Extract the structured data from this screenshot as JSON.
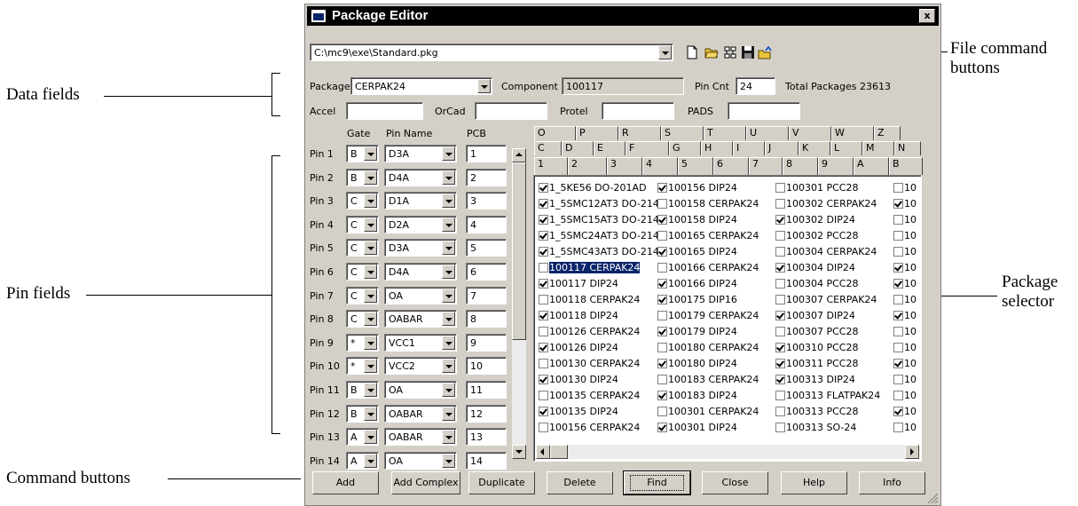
{
  "annotations": {
    "data_fields": "Data fields",
    "pin_fields": "Pin fields",
    "command_buttons": "Command buttons",
    "file_command_buttons_line1": "File command",
    "file_command_buttons_line2": "buttons",
    "package_selector_line1": "Package",
    "package_selector_line2": "selector"
  },
  "window": {
    "title": "Package Editor",
    "close_glyph": "x",
    "file_path": "C:\\mc9\\exe\\Standard.pkg",
    "file_icons": [
      "new-file-icon",
      "open-folder-icon",
      "tree-icon",
      "save-disk-icon",
      "export-folder-icon"
    ]
  },
  "data_fields": {
    "package_label": "Package",
    "package_value": "CERPAK24",
    "component_label": "Component",
    "component_value": "100117",
    "pin_cnt_label": "Pin Cnt",
    "pin_cnt_value": "24",
    "total_packages": "Total Packages 23613",
    "accel_label": "Accel",
    "accel_value": "",
    "orcad_label": "OrCad",
    "orcad_value": "",
    "protel_label": "Protel",
    "protel_value": "",
    "pads_label": "PADS",
    "pads_value": ""
  },
  "pin_headers": {
    "gate": "Gate",
    "pin_name": "Pin Name",
    "pcb": "PCB"
  },
  "pins": [
    {
      "label": "Pin 1",
      "gate": "B",
      "name": "D3A",
      "pcb": "1"
    },
    {
      "label": "Pin 2",
      "gate": "B",
      "name": "D4A",
      "pcb": "2"
    },
    {
      "label": "Pin 3",
      "gate": "C",
      "name": "D1A",
      "pcb": "3"
    },
    {
      "label": "Pin 4",
      "gate": "C",
      "name": "D2A",
      "pcb": "4"
    },
    {
      "label": "Pin 5",
      "gate": "C",
      "name": "D3A",
      "pcb": "5"
    },
    {
      "label": "Pin 6",
      "gate": "C",
      "name": "D4A",
      "pcb": "6"
    },
    {
      "label": "Pin 7",
      "gate": "C",
      "name": "OA",
      "pcb": "7"
    },
    {
      "label": "Pin 8",
      "gate": "C",
      "name": "OABAR",
      "pcb": "8"
    },
    {
      "label": "Pin 9",
      "gate": "*",
      "name": "VCC1",
      "pcb": "9"
    },
    {
      "label": "Pin 10",
      "gate": "*",
      "name": "VCC2",
      "pcb": "10"
    },
    {
      "label": "Pin 11",
      "gate": "B",
      "name": "OA",
      "pcb": "11"
    },
    {
      "label": "Pin 12",
      "gate": "B",
      "name": "OABAR",
      "pcb": "12"
    },
    {
      "label": "Pin 13",
      "gate": "A",
      "name": "OABAR",
      "pcb": "13"
    },
    {
      "label": "Pin 14",
      "gate": "A",
      "name": "OA",
      "pcb": "14"
    }
  ],
  "tabs": {
    "row1": [
      "O",
      "P",
      "R",
      "S",
      "T",
      "U",
      "V",
      "W",
      "Z"
    ],
    "row2": [
      "C",
      "D",
      "E",
      "F",
      "G",
      "H",
      "I",
      "J",
      "K",
      "L",
      "M",
      "N"
    ],
    "row3": [
      "1",
      "2",
      "3",
      "4",
      "5",
      "6",
      "7",
      "8",
      "9",
      "A",
      "B"
    ]
  },
  "package_list": [
    [
      {
        "text": "1_5KE56 DO-201AD",
        "checked": true
      },
      {
        "text": "1_5SMC12AT3 DO-214",
        "checked": true
      },
      {
        "text": "1_5SMC15AT3 DO-214",
        "checked": true
      },
      {
        "text": "1_5SMC24AT3 DO-214",
        "checked": true
      },
      {
        "text": "1_5SMC43AT3 DO-214",
        "checked": true
      },
      {
        "text": "100117 CERPAK24",
        "checked": false,
        "selected": true
      },
      {
        "text": "100117 DIP24",
        "checked": true
      },
      {
        "text": "100118 CERPAK24",
        "checked": false
      },
      {
        "text": "100118 DIP24",
        "checked": true
      },
      {
        "text": "100126 CERPAK24",
        "checked": false
      },
      {
        "text": "100126 DIP24",
        "checked": true
      },
      {
        "text": "100130 CERPAK24",
        "checked": false
      },
      {
        "text": "100130 DIP24",
        "checked": true
      },
      {
        "text": "100135 CERPAK24",
        "checked": false
      },
      {
        "text": "100135 DIP24",
        "checked": true
      },
      {
        "text": "100156 CERPAK24",
        "checked": false
      }
    ],
    [
      {
        "text": "100156 DIP24",
        "checked": true
      },
      {
        "text": "100158 CERPAK24",
        "checked": false
      },
      {
        "text": "100158 DIP24",
        "checked": true
      },
      {
        "text": "100165 CERPAK24",
        "checked": false
      },
      {
        "text": "100165 DIP24",
        "checked": true
      },
      {
        "text": "100166 CERPAK24",
        "checked": false
      },
      {
        "text": "100166 DIP24",
        "checked": true
      },
      {
        "text": "100175 DIP16",
        "checked": true
      },
      {
        "text": "100179 CERPAK24",
        "checked": false
      },
      {
        "text": "100179 DIP24",
        "checked": true
      },
      {
        "text": "100180 CERPAK24",
        "checked": false
      },
      {
        "text": "100180 DIP24",
        "checked": true
      },
      {
        "text": "100183 CERPAK24",
        "checked": false
      },
      {
        "text": "100183 DIP24",
        "checked": true
      },
      {
        "text": "100301 CERPAK24",
        "checked": false
      },
      {
        "text": "100301 DIP24",
        "checked": true
      }
    ],
    [
      {
        "text": "100301 PCC28",
        "checked": false
      },
      {
        "text": "100302 CERPAK24",
        "checked": false
      },
      {
        "text": "100302 DIP24",
        "checked": true
      },
      {
        "text": "100302 PCC28",
        "checked": false
      },
      {
        "text": "100304 CERPAK24",
        "checked": false
      },
      {
        "text": "100304 DIP24",
        "checked": true
      },
      {
        "text": "100304 PCC28",
        "checked": false
      },
      {
        "text": "100307 CERPAK24",
        "checked": false
      },
      {
        "text": "100307 DIP24",
        "checked": true
      },
      {
        "text": "100307 PCC28",
        "checked": false
      },
      {
        "text": "100310 PCC28",
        "checked": true
      },
      {
        "text": "100311 PCC28",
        "checked": true
      },
      {
        "text": "100313 DIP24",
        "checked": true
      },
      {
        "text": "100313 FLATPAK24",
        "checked": false
      },
      {
        "text": "100313 PCC28",
        "checked": false
      },
      {
        "text": "100313 SO-24",
        "checked": false
      }
    ],
    [
      {
        "text": "10",
        "checked": false
      },
      {
        "text": "10",
        "checked": true
      },
      {
        "text": "10",
        "checked": false
      },
      {
        "text": "10",
        "checked": false
      },
      {
        "text": "10",
        "checked": false
      },
      {
        "text": "10",
        "checked": true
      },
      {
        "text": "10",
        "checked": true
      },
      {
        "text": "10",
        "checked": false
      },
      {
        "text": "10",
        "checked": true
      },
      {
        "text": "10",
        "checked": false
      },
      {
        "text": "10",
        "checked": false
      },
      {
        "text": "10",
        "checked": true
      },
      {
        "text": "10",
        "checked": false
      },
      {
        "text": "10",
        "checked": false
      },
      {
        "text": "10",
        "checked": true
      },
      {
        "text": "10",
        "checked": false
      }
    ]
  ],
  "commands": [
    {
      "label": "Add",
      "name": "add-button"
    },
    {
      "label": "Add Complex",
      "name": "add-complex-button"
    },
    {
      "label": "Duplicate",
      "name": "duplicate-button"
    },
    {
      "label": "Delete",
      "name": "delete-button"
    },
    {
      "label": "Find",
      "name": "find-button",
      "default": true
    },
    {
      "label": "Close",
      "name": "close-button"
    },
    {
      "label": "Help",
      "name": "help-button"
    },
    {
      "label": "Info",
      "name": "info-button"
    }
  ],
  "colors": {
    "window_bg": "#d4d0c8",
    "titlebar": "#000000",
    "selection": "#0a246a"
  }
}
